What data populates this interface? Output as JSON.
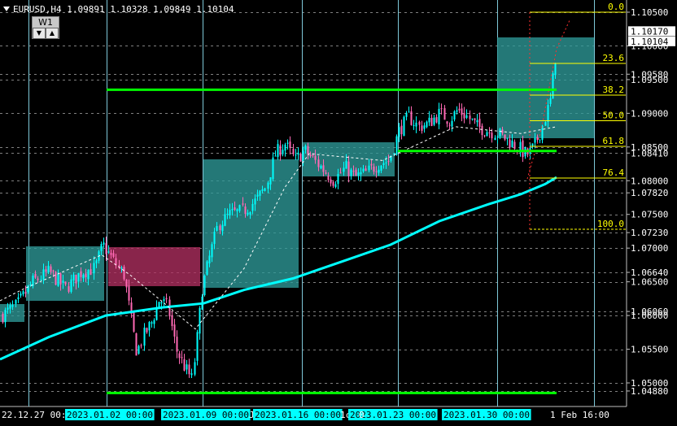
{
  "header": {
    "symbol_line": "EURUSD,H4  1.09891 1.10328 1.09849 1.10104"
  },
  "timeframe_widget": {
    "label": "W1",
    "down": "▼",
    "up": "▲"
  },
  "chart_data": {
    "type": "candlestick",
    "price_labels": [
      "1.10500",
      "1.10000",
      "1.09580",
      "1.09500",
      "1.09000",
      "1.08500",
      "1.08410",
      "1.08000",
      "1.07820",
      "1.07500",
      "1.07230",
      "1.07000",
      "1.06640",
      "1.06500",
      "1.06060",
      "1.06000",
      "1.05500",
      "1.05000",
      "1.04880"
    ],
    "price_tags": [
      {
        "value": "1.10170",
        "color": "#ffffff",
        "text": "#000000"
      },
      {
        "value": "1.10104",
        "color": "#ffffff",
        "text": "#000000"
      }
    ],
    "date_labels": [
      "22.12.27 00:0",
      "2023.01.02 00:00",
      "2023.01.09 00:00",
      "Ja",
      "2023.01.16 00:00",
      "1c",
      "2023.01.23 00:00",
      "0",
      "2023.01.30 00:00",
      "1 Feb 16:00"
    ],
    "highlighted_date_labels": [
      "2023.01.02 00:00",
      "2023.01.09 00:00",
      "2023.01.16 00:00",
      "2023.01.23 00:00",
      "2023.01.30 00:00"
    ],
    "fibonacci": {
      "levels": [
        "0.0",
        "23.6",
        "38.2",
        "50.0",
        "61.8",
        "76.4",
        "100.0"
      ],
      "prices": [
        1.105,
        1.0974,
        1.0927,
        1.0889,
        1.0851,
        1.0804,
        1.0728
      ]
    },
    "horizontal_lines": [
      {
        "price": 1.0935,
        "color": "#00ff00"
      },
      {
        "price": 1.0844,
        "color": "#00ff00"
      },
      {
        "price": 1.0485,
        "color": "#00ff00"
      }
    ],
    "colors": {
      "bull": "#00ffff",
      "bear": "#ff69b4",
      "moving_average": "#00ffff",
      "box_teal": "#2e9a98",
      "box_red": "#b03060",
      "fib": "#ffff00",
      "grid": "#808080",
      "vline": "#7ec8d8"
    }
  }
}
